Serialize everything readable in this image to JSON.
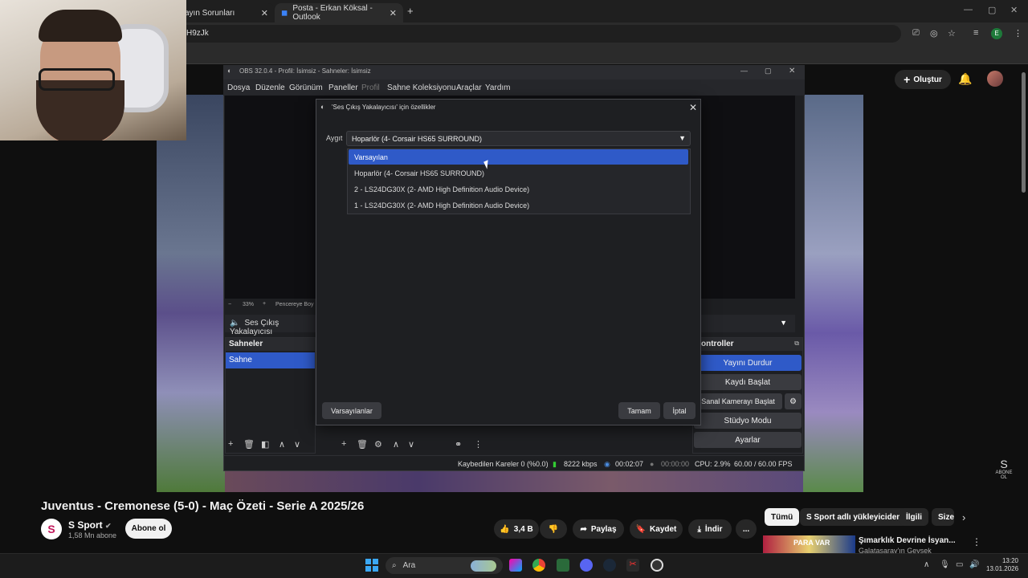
{
  "browser": {
    "tabs": [
      {
        "label": "ayın Sorunları"
      },
      {
        "label": "Posta - Erkan Köksal - Outlook"
      }
    ],
    "new_tab": "+",
    "url": "H9zJk",
    "profile_letter": "E"
  },
  "youtube": {
    "create_label": "Oluştur",
    "video_title": "Juventus - Cremonese (5-0) - Maç Özeti - Serie A 2025/26",
    "channel_name": "S Sport",
    "channel_avatar": "S",
    "subscribers": "1,58 Mn abone",
    "subscribe_label": "Abone ol",
    "like_count": "3,4 B",
    "share_label": "Paylaş",
    "save_label": "Kaydet",
    "download_label": "İndir",
    "more_label": "...",
    "chips": [
      "Tümü",
      "S Sport adlı yükleyiciden",
      "İlgili",
      "Size"
    ],
    "related_title": "Şımarklık Devrine İsyan...",
    "related_sub": "Galatasaray'ın Gevşek",
    "thumb_text": "PARA VAR",
    "brand": "ABONE OL"
  },
  "obs": {
    "title": "OBS 32.0.4 - Profil: İsimsiz - Sahneler: İsimsiz",
    "menu": [
      "Dosya",
      "Düzenle",
      "Görünüm",
      "Paneller",
      "Profil",
      "Sahne Koleksiyonu",
      "Araçlar",
      "Yardım"
    ],
    "zoom": "33%",
    "zoom_fit": "Pencereye Boy",
    "source_label": "Ses Çıkış Yakalayıcısı",
    "scenes_header": "Sahneler",
    "scene_item": "Sahne",
    "controls_header": "ontroller",
    "controls": [
      "Yayını Durdur",
      "Kaydı Başlat",
      "Sanal Kamerayı Başlat",
      "Stüdyo Modu",
      "Ayarlar"
    ],
    "status": {
      "dropped": "Kaybedilen Kareler 0 (%0.0)",
      "bitrate": "8222 kbps",
      "stream_time": "00:02:07",
      "rec_time": "00:00:00",
      "cpu": "CPU: 2.9%",
      "fps": "60.00 / 60.00 FPS"
    }
  },
  "dialog": {
    "title": "'Ses Çıkış Yakalayıcısı' için özellikler",
    "device_label": "Aygıt",
    "device_value": "Hoparlör (4- Corsair HS65 SURROUND)",
    "options": [
      "Varsayılan",
      "Hoparlör (4- Corsair HS65 SURROUND)",
      "2 - LS24DG30X (2- AMD High Definition Audio Device)",
      "1 - LS24DG30X (2- AMD High Definition Audio Device)"
    ],
    "defaults_btn": "Varsayılanlar",
    "ok_btn": "Tamam",
    "cancel_btn": "İptal"
  },
  "taskbar": {
    "search": "Ara",
    "time": "13:20",
    "date": "13.01.2026"
  }
}
